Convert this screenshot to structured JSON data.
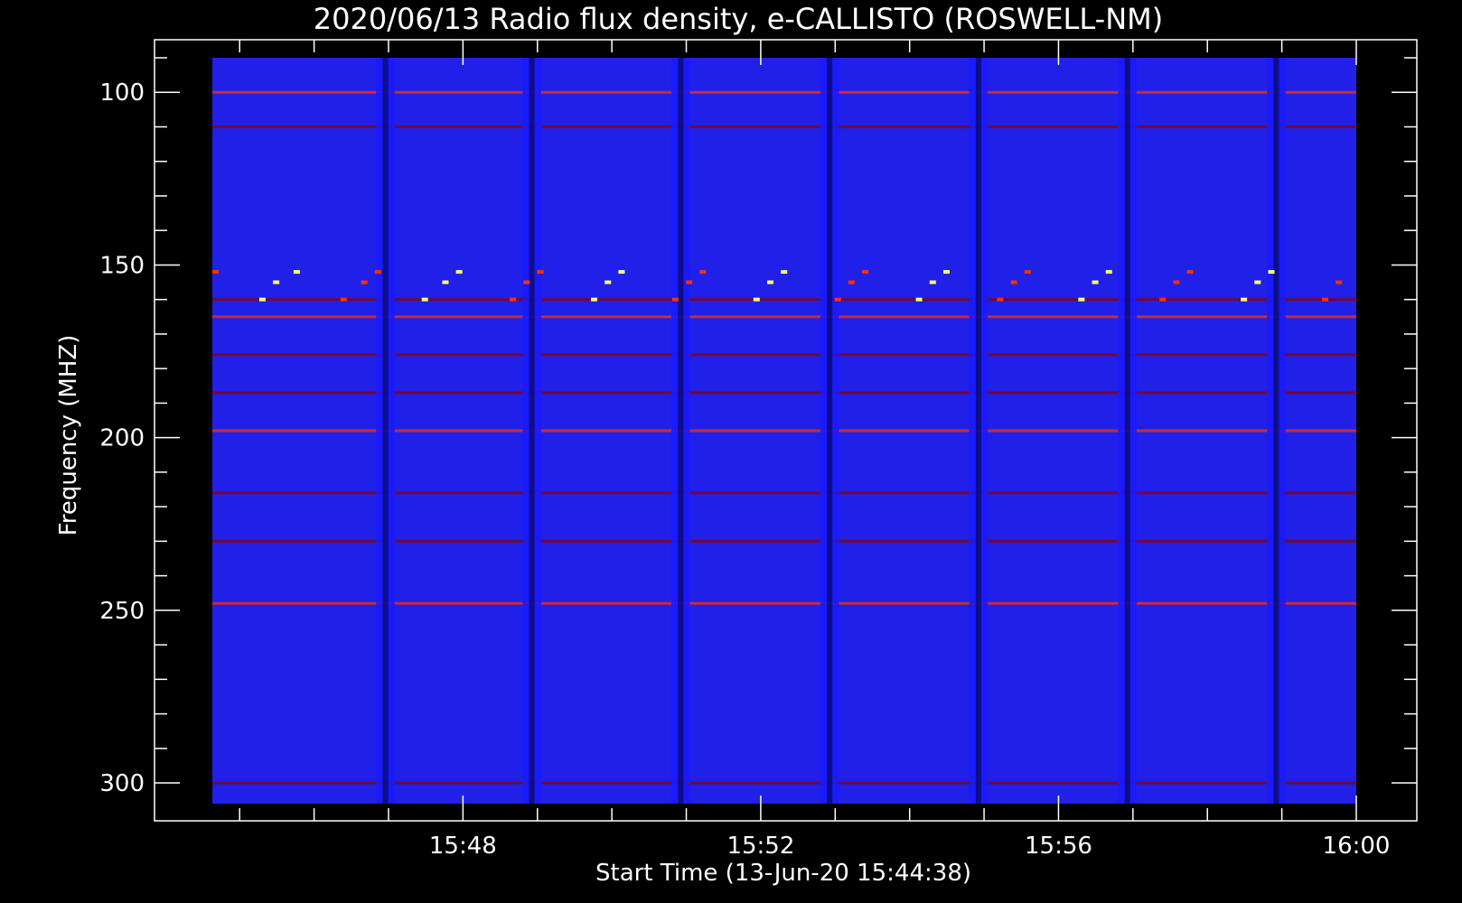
{
  "chart_data": {
    "type": "heatmap",
    "title": "2020/06/13  Radio flux density, e-CALLISTO (ROSWELL-NM)",
    "xlabel": "Start Time (13-Jun-20 15:44:38)",
    "ylabel": "Frequency (MHZ)",
    "x_unit": "time (HH:MM)",
    "xlim": [
      "15:44:38",
      "16:00:00"
    ],
    "ylim": [
      90,
      306
    ],
    "y_axis_inverted": true,
    "x_ticks": [
      "15:48",
      "15:52",
      "15:56",
      "16:00"
    ],
    "x_minor_tick_minutes": 1,
    "y_ticks": [
      100,
      150,
      200,
      250,
      300
    ],
    "y_minor_tick_step": 10,
    "colormap": [
      "#000000",
      "#1a1aff",
      "#1e1eff",
      "#8b0000",
      "#ff3000",
      "#ffff80"
    ],
    "background_color": "#2020e8",
    "calibration_gaps_start": [
      "15:46:50",
      "15:48:48",
      "15:50:48",
      "15:52:48",
      "15:54:48",
      "15:56:48",
      "15:58:48"
    ],
    "calibration_gap_width_sec": 15,
    "persistent_emission_lines_mhz": [
      100,
      110,
      160,
      165,
      176,
      187,
      198,
      216,
      230,
      248,
      300
    ],
    "intermittent_bright_spots_mhz": [
      152,
      155,
      160
    ]
  }
}
